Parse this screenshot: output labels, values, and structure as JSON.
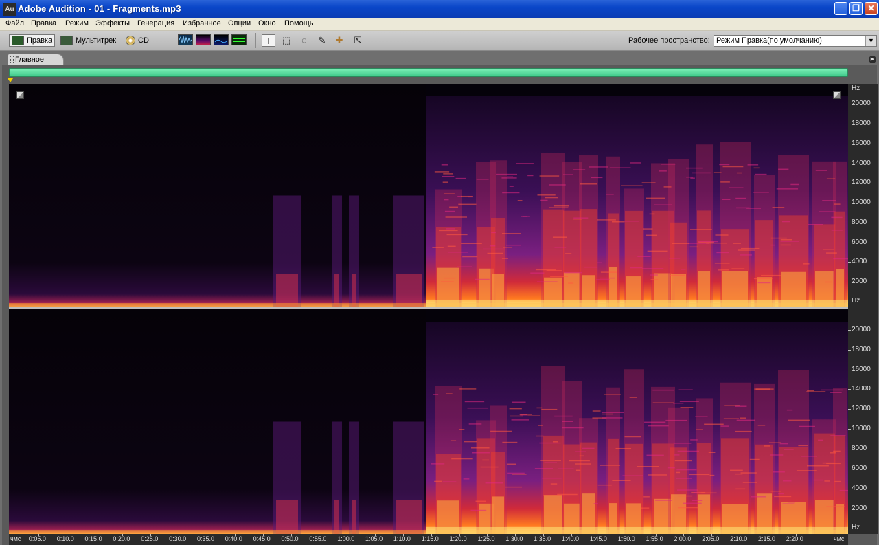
{
  "window": {
    "app_icon_text": "Au",
    "title": "Adobe Audition - 01 - Fragments.mp3",
    "minimize_label": "_",
    "restore_label": "❐",
    "close_label": "✕"
  },
  "menu": {
    "items": [
      "Файл",
      "Правка",
      "Режим",
      "Эффекты",
      "Генерация",
      "Избранное",
      "Опции",
      "Окно",
      "Помощь"
    ]
  },
  "toolbar": {
    "modes": [
      "Правка",
      "Мультитрек",
      "CD"
    ],
    "workspace_label": "Рабочее пространство:",
    "workspace_value": "Режим Правка(по умолчанию)",
    "view_buttons": [
      "waveform-view",
      "spectral-frequency-view",
      "spectral-pan-view",
      "spectral-phase-view"
    ],
    "tools": [
      "time-selection-icon",
      "marquee-icon",
      "lasso-icon",
      "brush-icon",
      "spot-healing-icon",
      "scrub-icon"
    ]
  },
  "panel": {
    "tab_label": "Главное"
  },
  "rulers": {
    "hz_unit": "Hz",
    "hz_labels": [
      "20000",
      "18000",
      "16000",
      "14000",
      "12000",
      "10000",
      "8000",
      "6000",
      "4000",
      "2000"
    ],
    "time_start": "чмс",
    "time_end": "чмс",
    "time_labels": [
      "0:05.0",
      "0:10.0",
      "0:15.0",
      "0:20.0",
      "0:25.0",
      "0:30.0",
      "0:35.0",
      "0:40.0",
      "0:45.0",
      "0:50.0",
      "0:55.0",
      "1:00.0",
      "1:05.0",
      "1:10.0",
      "1:15.0",
      "1:20.0",
      "1:25.0",
      "1:30.0",
      "1:35.0",
      "1:40.0",
      "1:45.0",
      "1:50.0",
      "1:55.0",
      "2:00.0",
      "2:05.0",
      "2:10.0",
      "2:15.0",
      "2:20.0"
    ]
  },
  "colors": {
    "titlebar": "#0a46c8",
    "overview_bar": "#3ec88a",
    "playhead": "#f3d000",
    "spectrum_low": "#000000",
    "spectrum_mid": "#7a1fa0",
    "spectrum_high": "#e8201a",
    "spectrum_peak": "#ffe070"
  }
}
